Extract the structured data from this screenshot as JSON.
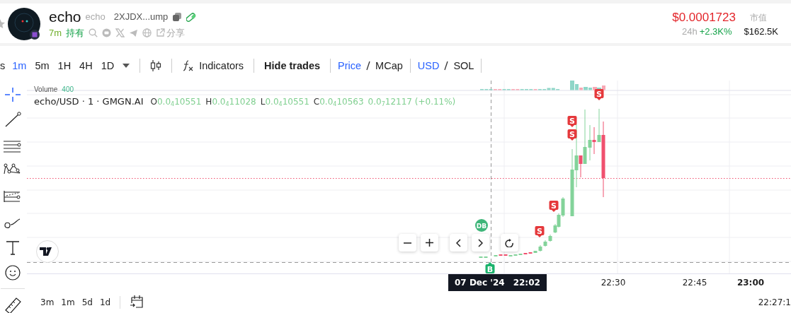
{
  "header": {
    "token_name": "echo",
    "symbol": "echo",
    "address": "2XJDX...ump",
    "age": "7m",
    "holding_label": "持有",
    "share_label": "分享",
    "price": "$0.0001723",
    "market_cap_label": "市值",
    "change_period": "24h",
    "change": "+2.3K%",
    "market_cap": "$162.5K"
  },
  "toolbar": {
    "intervals": [
      {
        "label": "s",
        "selected": false
      },
      {
        "label": "1m",
        "selected": true
      },
      {
        "label": "5m",
        "selected": false
      },
      {
        "label": "1H",
        "selected": false
      },
      {
        "label": "4H",
        "selected": false
      },
      {
        "label": "1D",
        "selected": false
      }
    ],
    "indicators_label": "Indicators",
    "hide_trades_label": "Hide trades",
    "value_modes": [
      {
        "label": "Price",
        "selected": true
      },
      {
        "label": "MCap",
        "selected": false
      }
    ],
    "currencies": [
      {
        "label": "USD",
        "selected": true
      },
      {
        "label": "SOL",
        "selected": false
      }
    ]
  },
  "chart": {
    "volume_label": "Volume",
    "volume_value": "400",
    "legend": {
      "title": "echo/USD · 1 · GMGN.AI",
      "open_label": "O",
      "open": "0.0$_{4}$10551",
      "high_label": "H",
      "high": "0.0$_{4}$11028",
      "low_label": "L",
      "low": "0.0$_{4}$10551",
      "close_label": "C",
      "close": "0.0$_{4}$10563",
      "change": "0.0$_{7}$12117 (+0.11%)"
    },
    "trade_markers": [
      {
        "kind": "sell",
        "label": "S"
      },
      {
        "kind": "sell",
        "label": "S"
      },
      {
        "kind": "sell",
        "label": "S"
      },
      {
        "kind": "sell",
        "label": "S"
      },
      {
        "kind": "sell",
        "label": "S"
      },
      {
        "kind": "buy",
        "label": "B"
      },
      {
        "kind": "dev",
        "label": "DB"
      }
    ]
  },
  "time_axis": {
    "crosshair_date": "07 Dec '24",
    "crosshair_time": "22:02",
    "ticks": [
      {
        "label": "22:30",
        "emphasized": false
      },
      {
        "label": "22:45",
        "emphasized": false
      },
      {
        "label": "23:00",
        "emphasized": true
      }
    ]
  },
  "footer": {
    "ranges": [
      {
        "label": "3m"
      },
      {
        "label": "1m"
      },
      {
        "label": "5d"
      },
      {
        "label": "1d"
      }
    ],
    "clock": "22:27:1"
  }
}
